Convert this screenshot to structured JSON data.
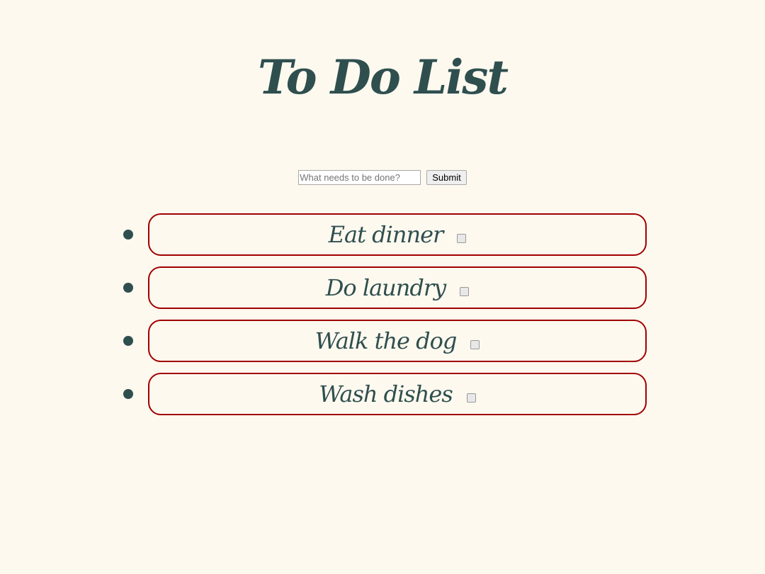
{
  "title": "To Do List",
  "form": {
    "placeholder": "What needs to be done?",
    "value": "",
    "submit_label": "Submit"
  },
  "todos": [
    {
      "text": "Eat dinner",
      "done": false
    },
    {
      "text": "Do laundry",
      "done": false
    },
    {
      "text": "Walk the dog",
      "done": false
    },
    {
      "text": "Wash dishes",
      "done": false
    }
  ],
  "colors": {
    "background": "#fef9ef",
    "text": "#2f4f4f",
    "border": "#a00000"
  }
}
